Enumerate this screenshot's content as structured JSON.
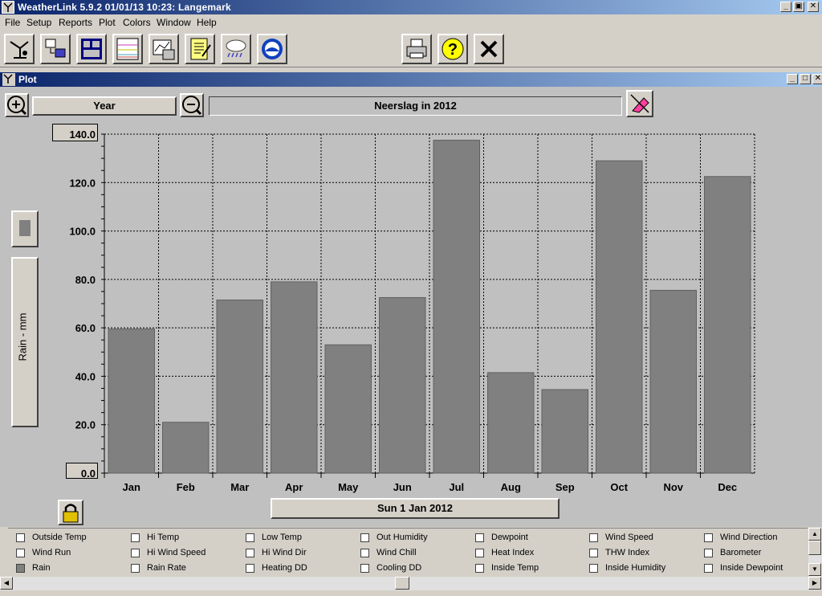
{
  "app": {
    "title": "WeatherLink 5.9.2  01/01/13  10:23: Langemark"
  },
  "menu": [
    "File",
    "Setup",
    "Reports",
    "Plot",
    "Colors",
    "Window",
    "Help"
  ],
  "toolbar": {
    "icons": [
      "station-icon",
      "download-icon",
      "bulletin-icon",
      "strip-chart-icon",
      "plot-icon",
      "notebook-icon",
      "weather-cloud-icon",
      "noaa-icon",
      "print-icon",
      "help-icon",
      "close-icon"
    ]
  },
  "plot_window": {
    "title": "Plot",
    "span_label": "Year",
    "plot_title": "Neerslag in 2012",
    "date_label": "Sun 1 Jan 2012",
    "ylabel": "Rain - mm"
  },
  "chart_data": {
    "type": "bar",
    "title": "Neerslag in 2012",
    "xlabel": "",
    "ylabel": "Rain - mm",
    "categories": [
      "Jan",
      "Feb",
      "Mar",
      "Apr",
      "May",
      "Jun",
      "Jul",
      "Aug",
      "Sep",
      "Oct",
      "Nov",
      "Dec"
    ],
    "values": [
      59.5,
      21.0,
      71.5,
      79.0,
      53.0,
      72.5,
      137.5,
      41.5,
      34.5,
      129.0,
      75.5,
      122.5
    ],
    "ylim": [
      0,
      140
    ],
    "yticks": [
      "0.0",
      "20.0",
      "40.0",
      "60.0",
      "80.0",
      "100.0",
      "120.0",
      "140.0"
    ],
    "grid": true,
    "bar_color": "#808080"
  },
  "legend": {
    "columns": [
      [
        {
          "label": "Outside Temp",
          "checked": false
        },
        {
          "label": "Wind Run",
          "checked": false
        },
        {
          "label": "Rain",
          "checked": true
        }
      ],
      [
        {
          "label": "Hi Temp",
          "checked": false
        },
        {
          "label": "Hi Wind Speed",
          "checked": false
        },
        {
          "label": "Rain Rate",
          "checked": false
        }
      ],
      [
        {
          "label": "Low Temp",
          "checked": false
        },
        {
          "label": "Hi Wind Dir",
          "checked": false
        },
        {
          "label": "Heating DD",
          "checked": false
        }
      ],
      [
        {
          "label": "Out Humidity",
          "checked": false
        },
        {
          "label": "Wind Chill",
          "checked": false
        },
        {
          "label": "Cooling DD",
          "checked": false
        }
      ],
      [
        {
          "label": "Dewpoint",
          "checked": false
        },
        {
          "label": "Heat Index",
          "checked": false
        },
        {
          "label": "Inside Temp",
          "checked": false
        }
      ],
      [
        {
          "label": "Wind Speed",
          "checked": false
        },
        {
          "label": "THW Index",
          "checked": false
        },
        {
          "label": "Inside Humidity",
          "checked": false
        }
      ],
      [
        {
          "label": "Wind Direction",
          "checked": false
        },
        {
          "label": "Barometer",
          "checked": false
        },
        {
          "label": "Inside Dewpoint",
          "checked": false
        }
      ]
    ]
  }
}
